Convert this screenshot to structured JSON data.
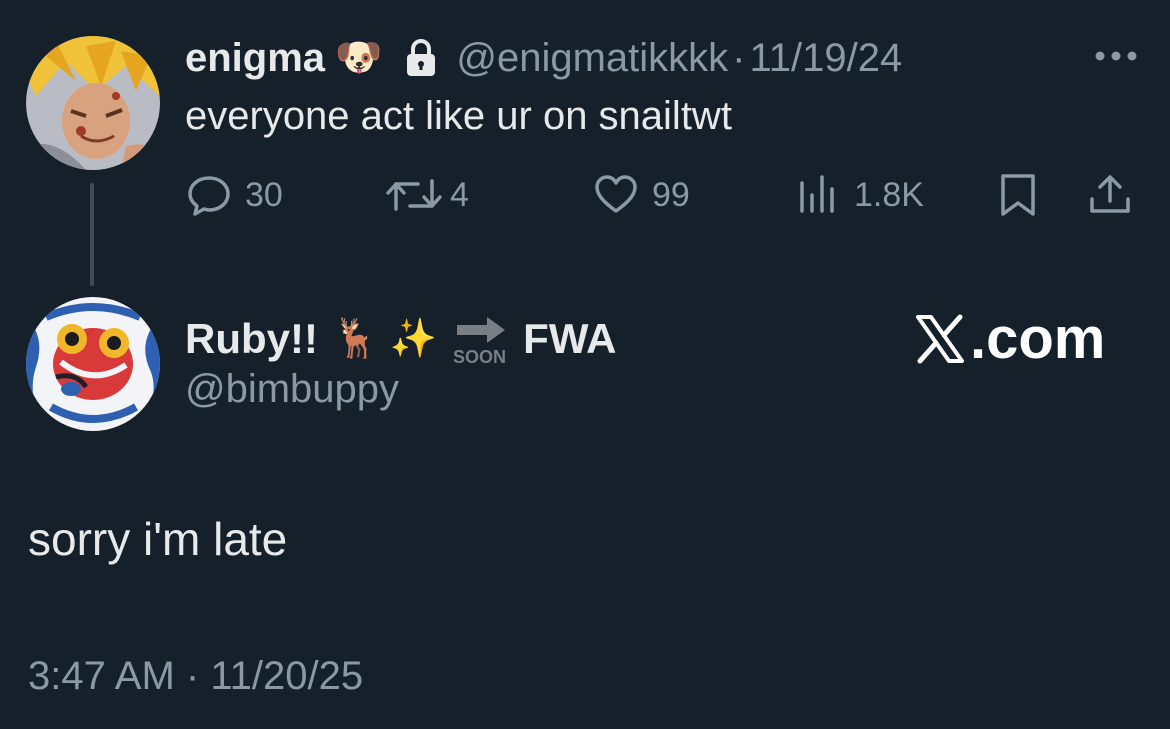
{
  "tweet1": {
    "display_name": "enigma",
    "name_emoji": "🐶",
    "handle": "@enigmatikkkk",
    "separator": "·",
    "date": "11/19/24",
    "text": "everyone act like ur on snailtwt",
    "stats": {
      "replies": "30",
      "retweets": "4",
      "likes": "99",
      "views": "1.8K"
    },
    "icons": [
      "avatar",
      "lock-icon",
      "more-icon",
      "reply-icon",
      "retweet-icon",
      "like-icon",
      "views-icon",
      "bookmark-icon",
      "share-icon"
    ]
  },
  "tweet2": {
    "display_name": "Ruby!!",
    "name_emojis": "🦌 ✨",
    "soon_label": "SOON",
    "name_suffix": "FWA",
    "handle": "@bimbuppy",
    "text": "sorry i'm late",
    "time": "3:47 AM",
    "separator": "·",
    "date": "11/20/25"
  },
  "watermark": {
    "text": ".com"
  },
  "colors": {
    "background": "#15202b",
    "primary_text": "#e7e9ea",
    "secondary_text": "#8b98a5"
  }
}
